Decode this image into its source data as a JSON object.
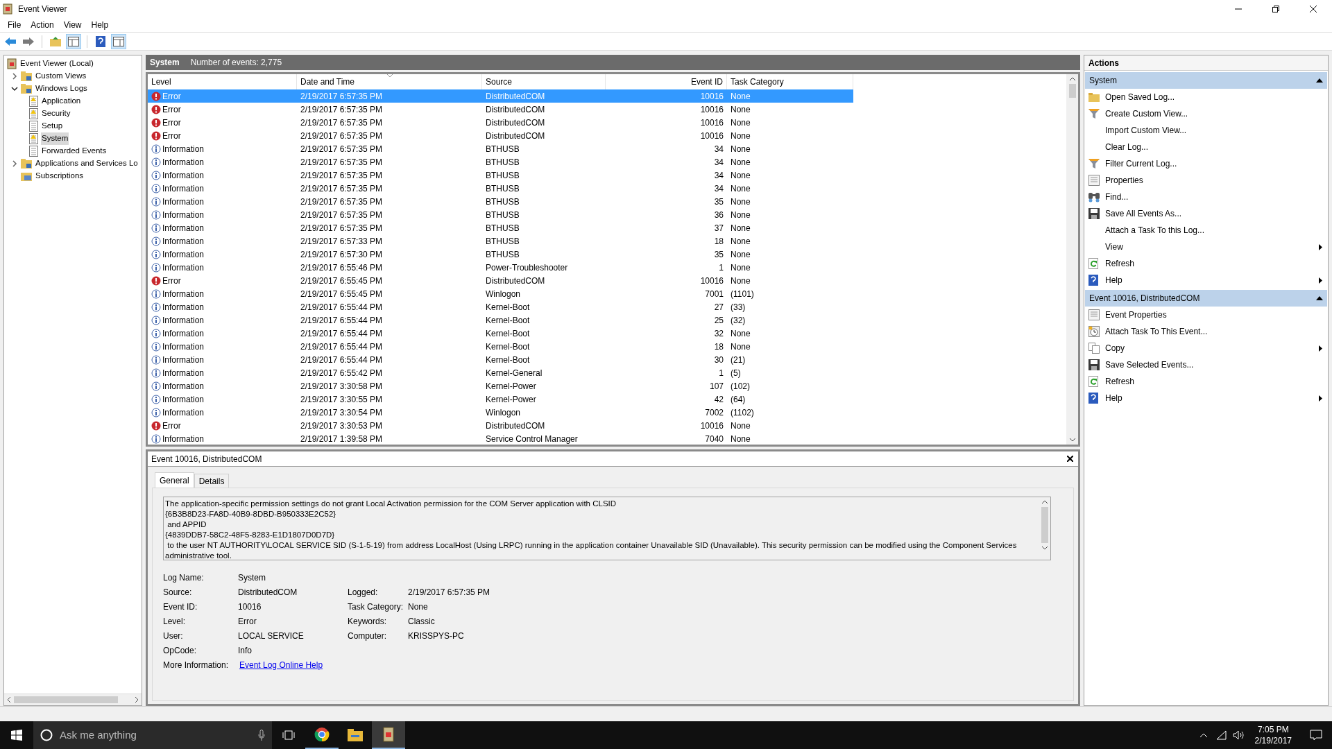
{
  "window": {
    "title": "Event Viewer"
  },
  "menu": [
    "File",
    "Action",
    "View",
    "Help"
  ],
  "tree": [
    {
      "label": "Event Viewer (Local)",
      "kind": "root",
      "selected": false,
      "children": [
        {
          "label": "Custom Views",
          "kind": "folder",
          "selected": false,
          "expanded": false
        },
        {
          "label": "Windows Logs",
          "kind": "folder",
          "selected": false,
          "expanded": true,
          "children": [
            {
              "label": "Application",
              "kind": "log",
              "selected": false
            },
            {
              "label": "Security",
              "kind": "log",
              "selected": false
            },
            {
              "label": "Setup",
              "kind": "plain",
              "selected": false
            },
            {
              "label": "System",
              "kind": "log",
              "selected": true
            },
            {
              "label": "Forwarded Events",
              "kind": "plain",
              "selected": false
            }
          ]
        },
        {
          "label": "Applications and Services Lo",
          "kind": "folder",
          "selected": false,
          "expanded": false
        },
        {
          "label": "Subscriptions",
          "kind": "leaf",
          "selected": false
        }
      ]
    }
  ],
  "log_header": {
    "name": "System",
    "count": "Number of events: 2,775"
  },
  "table": {
    "columns": [
      "Level",
      "Date and Time",
      "Source",
      "Event ID",
      "Task Category"
    ],
    "rows": [
      {
        "kind": "error",
        "level": "Error",
        "date": "2/19/2017 6:57:35 PM",
        "source": "DistributedCOM",
        "event_id": "10016",
        "task": "None",
        "selected": true
      },
      {
        "kind": "error",
        "level": "Error",
        "date": "2/19/2017 6:57:35 PM",
        "source": "DistributedCOM",
        "event_id": "10016",
        "task": "None",
        "selected": false
      },
      {
        "kind": "error",
        "level": "Error",
        "date": "2/19/2017 6:57:35 PM",
        "source": "DistributedCOM",
        "event_id": "10016",
        "task": "None",
        "selected": false
      },
      {
        "kind": "error",
        "level": "Error",
        "date": "2/19/2017 6:57:35 PM",
        "source": "DistributedCOM",
        "event_id": "10016",
        "task": "None",
        "selected": false
      },
      {
        "kind": "info",
        "level": "Information",
        "date": "2/19/2017 6:57:35 PM",
        "source": "BTHUSB",
        "event_id": "34",
        "task": "None",
        "selected": false
      },
      {
        "kind": "info",
        "level": "Information",
        "date": "2/19/2017 6:57:35 PM",
        "source": "BTHUSB",
        "event_id": "34",
        "task": "None",
        "selected": false
      },
      {
        "kind": "info",
        "level": "Information",
        "date": "2/19/2017 6:57:35 PM",
        "source": "BTHUSB",
        "event_id": "34",
        "task": "None",
        "selected": false
      },
      {
        "kind": "info",
        "level": "Information",
        "date": "2/19/2017 6:57:35 PM",
        "source": "BTHUSB",
        "event_id": "34",
        "task": "None",
        "selected": false
      },
      {
        "kind": "info",
        "level": "Information",
        "date": "2/19/2017 6:57:35 PM",
        "source": "BTHUSB",
        "event_id": "35",
        "task": "None",
        "selected": false
      },
      {
        "kind": "info",
        "level": "Information",
        "date": "2/19/2017 6:57:35 PM",
        "source": "BTHUSB",
        "event_id": "36",
        "task": "None",
        "selected": false
      },
      {
        "kind": "info",
        "level": "Information",
        "date": "2/19/2017 6:57:35 PM",
        "source": "BTHUSB",
        "event_id": "37",
        "task": "None",
        "selected": false
      },
      {
        "kind": "info",
        "level": "Information",
        "date": "2/19/2017 6:57:33 PM",
        "source": "BTHUSB",
        "event_id": "18",
        "task": "None",
        "selected": false
      },
      {
        "kind": "info",
        "level": "Information",
        "date": "2/19/2017 6:57:30 PM",
        "source": "BTHUSB",
        "event_id": "35",
        "task": "None",
        "selected": false
      },
      {
        "kind": "info",
        "level": "Information",
        "date": "2/19/2017 6:55:46 PM",
        "source": "Power-Troubleshooter",
        "event_id": "1",
        "task": "None",
        "selected": false
      },
      {
        "kind": "error",
        "level": "Error",
        "date": "2/19/2017 6:55:45 PM",
        "source": "DistributedCOM",
        "event_id": "10016",
        "task": "None",
        "selected": false
      },
      {
        "kind": "info",
        "level": "Information",
        "date": "2/19/2017 6:55:45 PM",
        "source": "Winlogon",
        "event_id": "7001",
        "task": "(1101)",
        "selected": false
      },
      {
        "kind": "info",
        "level": "Information",
        "date": "2/19/2017 6:55:44 PM",
        "source": "Kernel-Boot",
        "event_id": "27",
        "task": "(33)",
        "selected": false
      },
      {
        "kind": "info",
        "level": "Information",
        "date": "2/19/2017 6:55:44 PM",
        "source": "Kernel-Boot",
        "event_id": "25",
        "task": "(32)",
        "selected": false
      },
      {
        "kind": "info",
        "level": "Information",
        "date": "2/19/2017 6:55:44 PM",
        "source": "Kernel-Boot",
        "event_id": "32",
        "task": "None",
        "selected": false
      },
      {
        "kind": "info",
        "level": "Information",
        "date": "2/19/2017 6:55:44 PM",
        "source": "Kernel-Boot",
        "event_id": "18",
        "task": "None",
        "selected": false
      },
      {
        "kind": "info",
        "level": "Information",
        "date": "2/19/2017 6:55:44 PM",
        "source": "Kernel-Boot",
        "event_id": "30",
        "task": "(21)",
        "selected": false
      },
      {
        "kind": "info",
        "level": "Information",
        "date": "2/19/2017 6:55:42 PM",
        "source": "Kernel-General",
        "event_id": "1",
        "task": "(5)",
        "selected": false
      },
      {
        "kind": "info",
        "level": "Information",
        "date": "2/19/2017 3:30:58 PM",
        "source": "Kernel-Power",
        "event_id": "107",
        "task": "(102)",
        "selected": false
      },
      {
        "kind": "info",
        "level": "Information",
        "date": "2/19/2017 3:30:55 PM",
        "source": "Kernel-Power",
        "event_id": "42",
        "task": "(64)",
        "selected": false
      },
      {
        "kind": "info",
        "level": "Information",
        "date": "2/19/2017 3:30:54 PM",
        "source": "Winlogon",
        "event_id": "7002",
        "task": "(1102)",
        "selected": false
      },
      {
        "kind": "error",
        "level": "Error",
        "date": "2/19/2017 3:30:53 PM",
        "source": "DistributedCOM",
        "event_id": "10016",
        "task": "None",
        "selected": false
      },
      {
        "kind": "info",
        "level": "Information",
        "date": "2/19/2017 1:39:58 PM",
        "source": "Service Control Manager",
        "event_id": "7040",
        "task": "None",
        "selected": false
      }
    ]
  },
  "details": {
    "title": "Event 10016, DistributedCOM",
    "tabs": [
      {
        "label": "General",
        "selected": true
      },
      {
        "label": "Details",
        "selected": false
      }
    ],
    "message": [
      "The application-specific permission settings do not grant Local Activation permission for the COM Server application with CLSID",
      "{6B3B8D23-FA8D-40B9-8DBD-B950333E2C52}",
      " and APPID",
      "{4839DDB7-58C2-48F5-8283-E1D1807D0D7D}",
      " to the user NT AUTHORITY\\LOCAL SERVICE SID (S-1-5-19) from address LocalHost (Using LRPC) running in the application container Unavailable SID (Unavailable). This security permission can be modified using the Component Services administrative tool."
    ],
    "fields": [
      {
        "label": "Log Name:",
        "value": "System"
      },
      {
        "label": "Source:",
        "value": "DistributedCOM",
        "label2": "Logged:",
        "value2": "2/19/2017 6:57:35 PM"
      },
      {
        "label": "Event ID:",
        "value": "10016",
        "label2": "Task Category:",
        "value2": "None"
      },
      {
        "label": "Level:",
        "value": "Error",
        "label2": "Keywords:",
        "value2": "Classic"
      },
      {
        "label": "User:",
        "value": "LOCAL SERVICE",
        "label2": "Computer:",
        "value2": "KRISSPYS-PC"
      },
      {
        "label": "OpCode:",
        "value": "Info"
      }
    ],
    "more_info": {
      "label": "More Information:",
      "link": "Event Log Online Help"
    }
  },
  "actions": {
    "title": "Actions",
    "sections": [
      {
        "title": "System",
        "items": [
          {
            "label": "Open Saved Log...",
            "kind": "open",
            "submenu": false
          },
          {
            "label": "Create Custom View...",
            "kind": "filter",
            "submenu": false
          },
          {
            "label": "Import Custom View...",
            "kind": "none",
            "submenu": false
          },
          {
            "label": "Clear Log...",
            "kind": "none",
            "submenu": false
          },
          {
            "label": "Filter Current Log...",
            "kind": "filter",
            "submenu": false
          },
          {
            "label": "Properties",
            "kind": "properties",
            "submenu": false
          },
          {
            "label": "Find...",
            "kind": "find",
            "submenu": false
          },
          {
            "label": "Save All Events As...",
            "kind": "save",
            "submenu": false
          },
          {
            "label": "Attach a Task To this Log...",
            "kind": "none",
            "submenu": false
          },
          {
            "label": "View",
            "kind": "none",
            "submenu": true
          },
          {
            "label": "Refresh",
            "kind": "refresh",
            "submenu": false
          },
          {
            "label": "Help",
            "kind": "help",
            "submenu": true
          }
        ]
      },
      {
        "title": "Event 10016, DistributedCOM",
        "items": [
          {
            "label": "Event Properties",
            "kind": "properties",
            "submenu": false
          },
          {
            "label": "Attach Task To This Event...",
            "kind": "attach",
            "submenu": false
          },
          {
            "label": "Copy",
            "kind": "copy",
            "submenu": true
          },
          {
            "label": "Save Selected Events...",
            "kind": "save",
            "submenu": false
          },
          {
            "label": "Refresh",
            "kind": "refresh",
            "submenu": false
          },
          {
            "label": "Help",
            "kind": "help",
            "submenu": true
          }
        ]
      }
    ]
  },
  "taskbar": {
    "search_placeholder": "Ask me anything",
    "time": "7:05 PM",
    "date": "2/19/2017"
  }
}
